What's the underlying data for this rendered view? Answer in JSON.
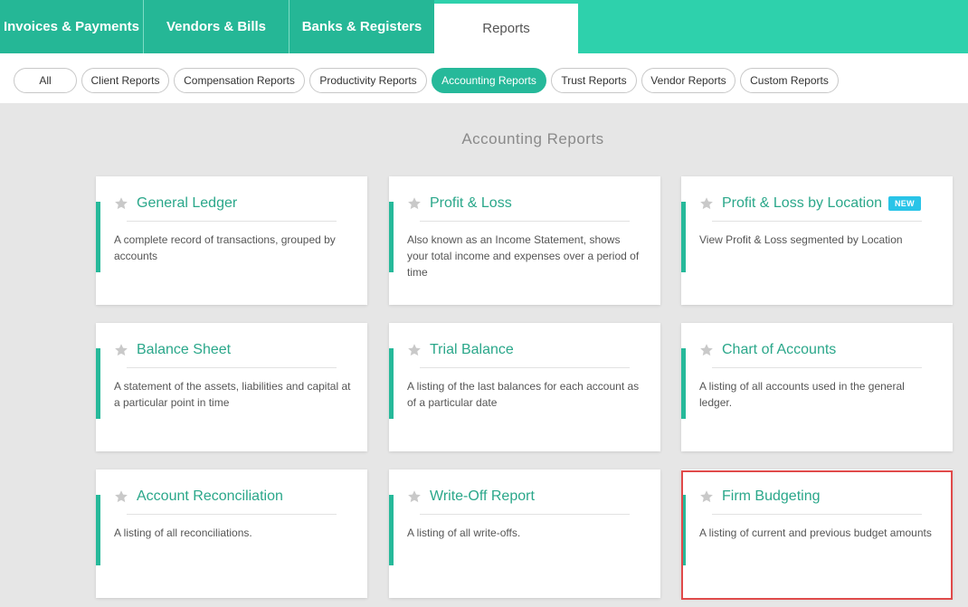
{
  "top_tabs": [
    {
      "label": "Invoices & Payments"
    },
    {
      "label": "Vendors & Bills"
    },
    {
      "label": "Banks & Registers"
    },
    {
      "label": "Reports"
    }
  ],
  "filters": [
    {
      "label": "All"
    },
    {
      "label": "Client Reports"
    },
    {
      "label": "Compensation Reports"
    },
    {
      "label": "Productivity Reports"
    },
    {
      "label": "Accounting Reports"
    },
    {
      "label": "Trust Reports"
    },
    {
      "label": "Vendor Reports"
    },
    {
      "label": "Custom Reports"
    }
  ],
  "section_title": "Accounting Reports",
  "cards": [
    {
      "title": "General Ledger",
      "desc": "A complete record of transactions, grouped by accounts"
    },
    {
      "title": "Profit & Loss",
      "desc": "Also known as an Income Statement, shows your total income and expenses over a period of time"
    },
    {
      "title": "Profit & Loss by Location",
      "badge": "NEW",
      "desc": "View Profit & Loss segmented by Location"
    },
    {
      "title": "Balance Sheet",
      "desc": "A statement of the assets, liabilities and capital at a particular point in time"
    },
    {
      "title": "Trial Balance",
      "desc": "A listing of the last balances for each account as of a particular date"
    },
    {
      "title": "Chart of Accounts",
      "desc": "A listing of all accounts used in the general ledger."
    },
    {
      "title": "Account Reconciliation",
      "desc": "A listing of all reconciliations."
    },
    {
      "title": "Write-Off Report",
      "desc": "A listing of all write-offs."
    },
    {
      "title": "Firm Budgeting",
      "desc": "A listing of current and previous budget amounts"
    }
  ],
  "colors": {
    "brand_teal": "#2ed1ac",
    "accent_green": "#26b99a",
    "new_badge": "#29c4e8",
    "highlight_red": "#e04a4a"
  },
  "icons": {
    "card_favorite": "star-icon"
  }
}
